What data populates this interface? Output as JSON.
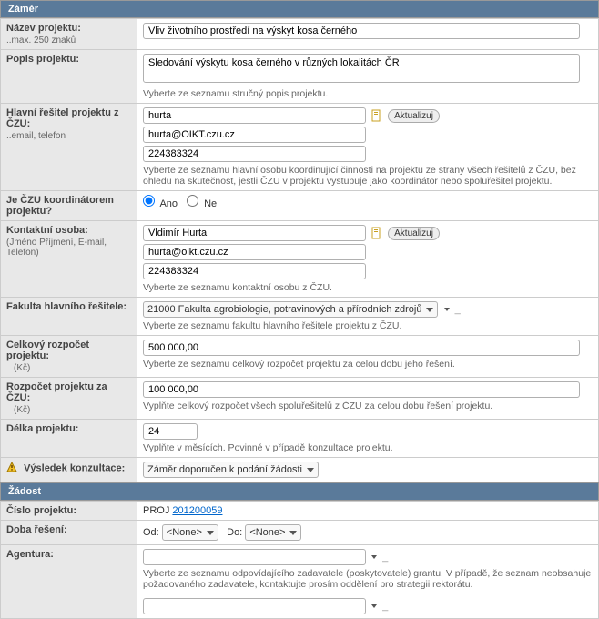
{
  "sections": {
    "zamer": "Záměr",
    "zadost": "Žádost"
  },
  "labels": {
    "nazev": "Název projektu:",
    "nazev_sub": "..max. 250 znaků",
    "popis": "Popis projektu:",
    "popis_hint": "Vyberte ze seznamu stručný popis projektu.",
    "hlavni_resitel": "Hlavní řešitel projektu z ČZU:",
    "hlavni_resitel_sub": "..email, telefon",
    "hlavni_resitel_hint": "Vyberte ze seznamu hlavní osobu koordinující činnosti na projektu ze strany všech řešitelů z ČZU, bez ohledu na skutečnost, jestli ČZU v projektu vystupuje jako koordinátor nebo spoluřešitel projektu.",
    "koordinator": "Je ČZU koordinátorem projektu?",
    "ano": "Ano",
    "ne": "Ne",
    "kontaktni": "Kontaktní osoba:",
    "kontaktni_sub": "(Jméno Příjmení, E-mail, Telefon)",
    "kontaktni_hint": "Vyberte ze seznamu kontaktní osobu z ČZU.",
    "fakulta": "Fakulta hlavního řešitele:",
    "fakulta_hint": "Vyberte ze seznamu fakultu hlavního řešitele projektu z ČZU.",
    "celkovy_rozpocet": "Celkový rozpočet projektu:",
    "kc": "(Kč)",
    "celkovy_hint": "Vyberte ze seznamu celkový rozpočet projektu za celou dobu jeho řešení.",
    "rozpocet_czu": "Rozpočet projektu za ČZU:",
    "rozpocet_czu_hint": "Vyplňte celkový rozpočet všech spoluřešitelů z ČZU za celou dobu řešení projektu.",
    "delka": "Délka projektu:",
    "delka_hint": "Vyplňte v měsících. Povinné v případě konzultace projektu.",
    "vysledek": "Výsledek konzultace:",
    "cislo": "Číslo projektu:",
    "doba": "Doba řešení:",
    "od": "Od:",
    "do": "Do:",
    "agentura": "Agentura:",
    "agentura_hint": "Vyberte ze seznamu odpovídajícího zadavatele (poskytovatele) grantu. V případě, že seznam neobsahuje požadovaného zadavatele, kontaktujte prosím oddělení pro strategii rektorátu.",
    "aktualizuj": "Aktualizuj",
    "none": "<None>"
  },
  "values": {
    "nazev": "Vliv životního prostředí na výskyt kosa černého",
    "popis": "Sledování výskytu kosa černého v různých lokalitách ČR",
    "resitel_name": "hurta",
    "resitel_email": "hurta@OIKT.czu.cz",
    "resitel_tel": "224383324",
    "kontakt_name": "Vldimír Hurta",
    "kontakt_email": "hurta@oikt.czu.cz",
    "kontakt_tel": "224383324",
    "fakulta": "21000 Fakulta agrobiologie, potravinových a přírodních zdrojů",
    "celkovy_rozpocet": "500 000,00",
    "rozpocet_czu": "100 000,00",
    "delka": "24",
    "vysledek": "Záměr doporučen k podání žádosti",
    "cislo_prefix": "PROJ ",
    "cislo_link": "201200059",
    "agentura": ""
  }
}
